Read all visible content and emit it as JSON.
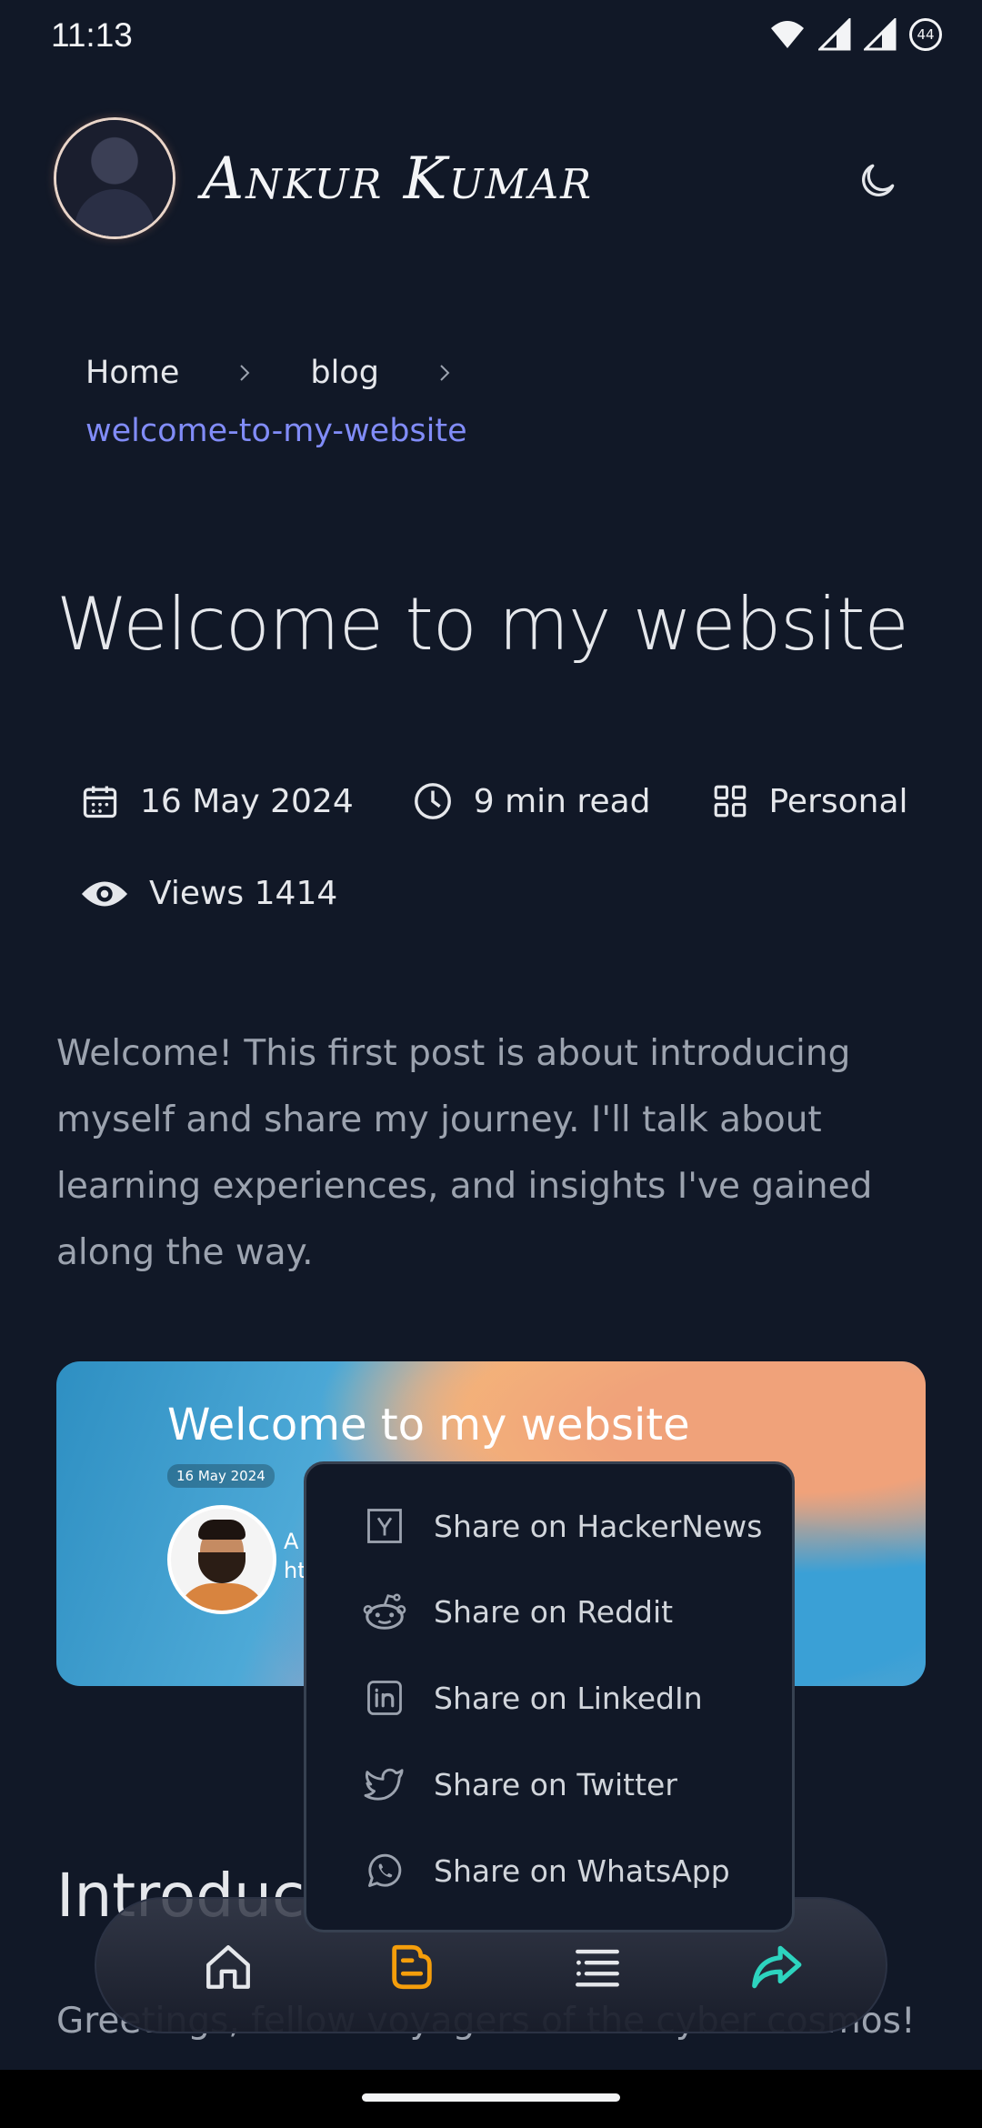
{
  "status": {
    "time": "11:13",
    "battery": "44"
  },
  "header": {
    "site_title": "Ankur Kumar"
  },
  "breadcrumb": {
    "home": "Home",
    "blog": "blog",
    "current": "welcome-to-my-website"
  },
  "post": {
    "title": "Welcome to my website",
    "date": "16 May 2024",
    "read_time": "9 min read",
    "category": "Personal",
    "views": "Views 1414",
    "intro": "Welcome! This first post is about introducing myself and share my journey. I'll talk about learning experiences, and insights I've gained along the way."
  },
  "hero": {
    "title": "Welcome to my website",
    "date": "16 May 2024",
    "name_partial": "A",
    "link_partial": "ht"
  },
  "share_menu": [
    {
      "label": "Share on HackerNews",
      "icon": "hackernews-icon"
    },
    {
      "label": "Share on Reddit",
      "icon": "reddit-icon"
    },
    {
      "label": "Share on LinkedIn",
      "icon": "linkedin-icon"
    },
    {
      "label": "Share on Twitter",
      "icon": "twitter-icon"
    },
    {
      "label": "Share on WhatsApp",
      "icon": "whatsapp-icon"
    }
  ],
  "content": {
    "section_heading": "Introduct",
    "section_text": "Greetings, fellow voyagers of the cyber cosmos!"
  },
  "bottom_nav": [
    {
      "icon": "home-icon"
    },
    {
      "icon": "blog-icon",
      "color": "#f59e0b"
    },
    {
      "icon": "toc-icon"
    },
    {
      "icon": "share-icon",
      "color": "#2dd4bf"
    }
  ],
  "colors": {
    "background": "#111827",
    "accent": "#818cf8",
    "muted": "#9ca3af"
  }
}
